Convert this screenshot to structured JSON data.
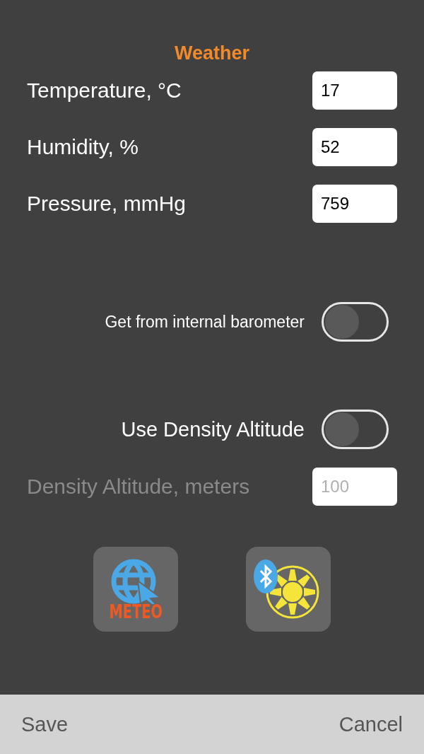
{
  "title": "Weather",
  "fields": [
    {
      "label": "Temperature, °C",
      "value": "17",
      "disabled": false
    },
    {
      "label": "Humidity, %",
      "value": "52",
      "disabled": false
    },
    {
      "label": "Pressure, mmHg",
      "value": "759",
      "disabled": false
    }
  ],
  "barometer_toggle": {
    "label": "Get from internal barometer",
    "on": false
  },
  "density_toggle": {
    "label": "Use Density Altitude",
    "on": false
  },
  "density_field": {
    "label": "Density Altitude, meters",
    "value": "100",
    "disabled": true
  },
  "meteo_button": {
    "label": "METEO"
  },
  "bottom_bar": {
    "save": "Save",
    "cancel": "Cancel"
  }
}
